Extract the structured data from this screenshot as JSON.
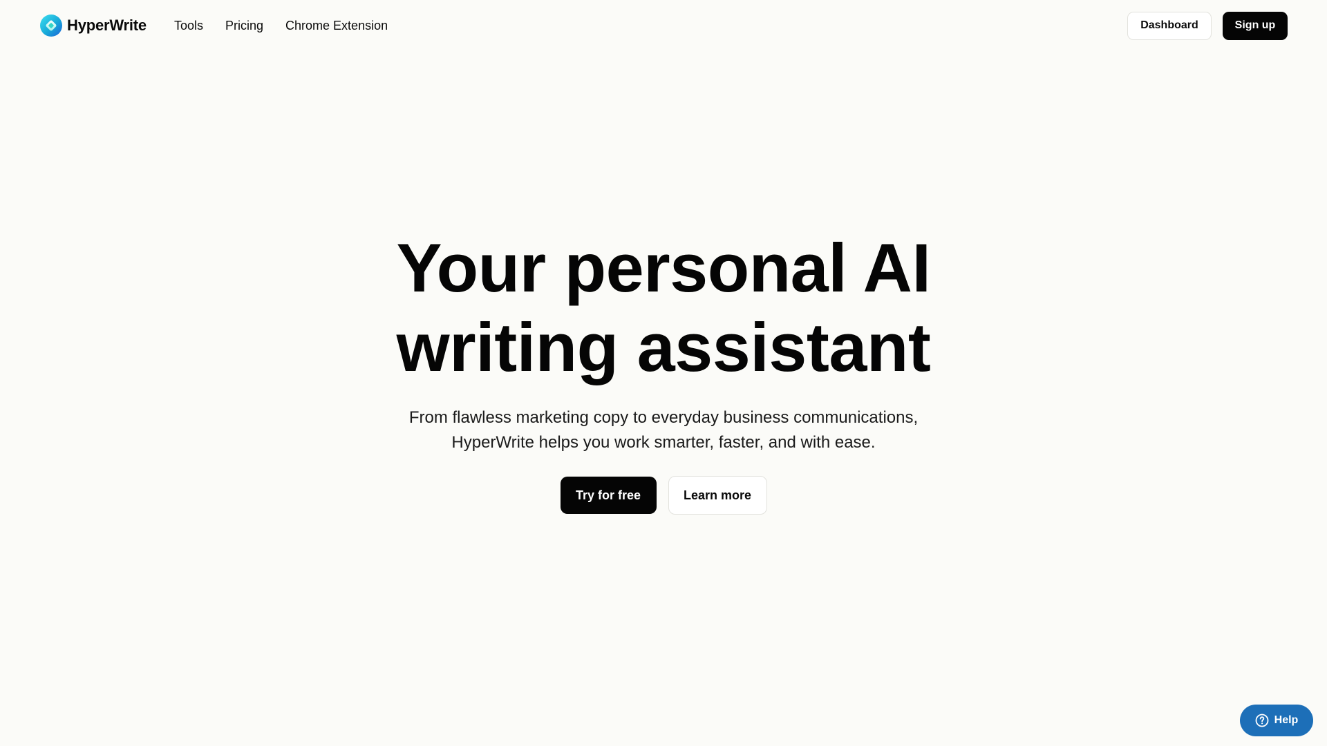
{
  "header": {
    "brand_name": "HyperWrite",
    "nav_links": [
      "Tools",
      "Pricing",
      "Chrome Extension"
    ],
    "dashboard_label": "Dashboard",
    "signup_label": "Sign up"
  },
  "hero": {
    "title_lines": [
      "Your personal AI",
      "writing assistant"
    ],
    "subtitle_lines": [
      "From flawless marketing copy to everyday business communications,",
      "HyperWrite helps you work smarter, faster, and with ease."
    ],
    "primary_cta": "Try for free",
    "secondary_cta": "Learn more"
  },
  "help_widget": {
    "label": "Help",
    "icon": "question-circle-icon"
  },
  "colors": {
    "background": "#fbfbf8",
    "primary_button": "#050505",
    "help_button": "#1d6fb8",
    "logo_gradient": [
      "#22d3ee",
      "#2563eb"
    ]
  }
}
